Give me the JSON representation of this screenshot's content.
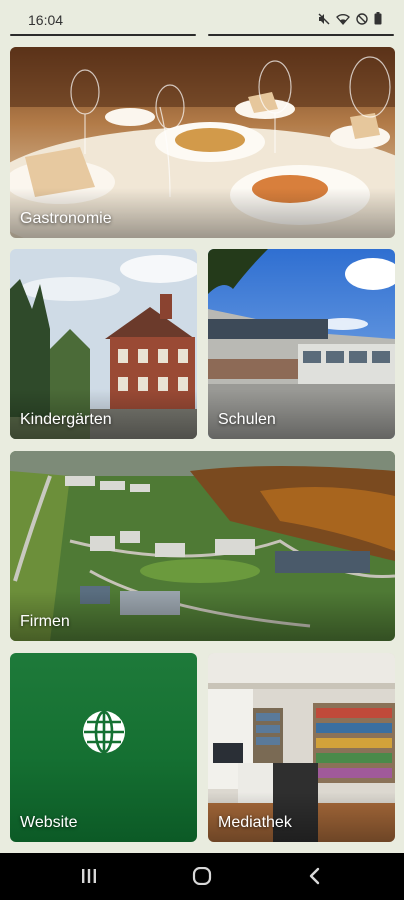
{
  "status_bar": {
    "time": "16:04",
    "icons": [
      "mute-icon",
      "wifi-icon",
      "do-not-disturb-icon",
      "battery-icon"
    ]
  },
  "tiles": [
    {
      "label": "Gastronomie",
      "image": "restaurant-table-photo"
    },
    {
      "label": "Kindergärten",
      "image": "kindergarten-building-photo"
    },
    {
      "label": "Schulen",
      "image": "school-building-photo"
    },
    {
      "label": "Firmen",
      "image": "industrial-park-aerial-photo"
    },
    {
      "label": "Website",
      "icon": "globe-icon"
    },
    {
      "label": "Mediathek",
      "image": "library-interior-photo"
    }
  ],
  "nav_bar": {
    "buttons": [
      "recent-apps-icon",
      "home-icon",
      "back-icon"
    ]
  },
  "colors": {
    "background": "#e9ecdf",
    "website_tile": "#157032",
    "nav_bar": "#000000"
  }
}
